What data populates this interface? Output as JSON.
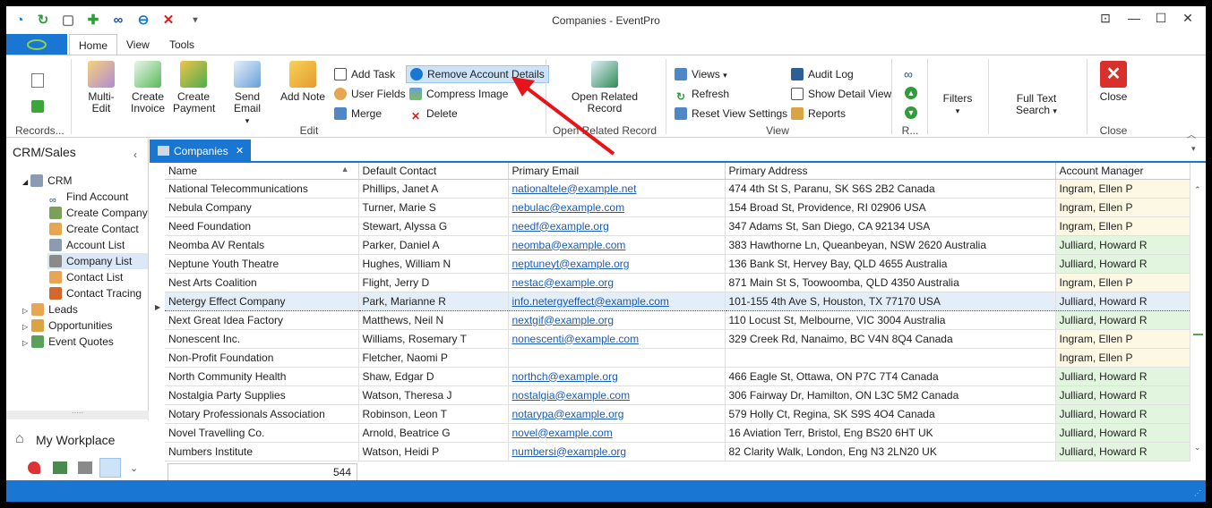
{
  "window": {
    "title": "Companies - EventPro"
  },
  "quick_access": [
    "app-icon",
    "refresh-icon",
    "new-icon",
    "add-icon",
    "find-icon",
    "remove-icon",
    "close-icon",
    "dropdown-icon"
  ],
  "ribbon_tabs": [
    {
      "label": "Home"
    },
    {
      "label": "View"
    },
    {
      "label": "Tools"
    }
  ],
  "ribbon": {
    "records": {
      "label": "Records..."
    },
    "edit": {
      "label": "Edit",
      "multi_edit": "Multi-Edit",
      "create_invoice": "Create Invoice",
      "create_payment": "Create Payment",
      "send_email": "Send Email",
      "add_note": "Add Note",
      "add_task": "Add Task",
      "user_fields": "User Fields",
      "merge": "Merge",
      "remove_account_details": "Remove Account Details",
      "compress_image": "Compress Image",
      "delete": "Delete"
    },
    "open_related": {
      "label": "Open Related Record",
      "button": "Open Related Record"
    },
    "view": {
      "label": "View",
      "views": "Views",
      "refresh": "Refresh",
      "reset_view_settings": "Reset View Settings",
      "audit_log": "Audit Log",
      "show_detail_view": "Show Detail View",
      "reports": "Reports"
    },
    "r_group": {
      "label": "R..."
    },
    "filters": "Filters",
    "full_text_search": "Full Text Search",
    "close": {
      "label": "Close",
      "button": "Close"
    }
  },
  "nav": {
    "title": "CRM/Sales",
    "crm": "CRM",
    "items": [
      "Find Account",
      "Create Company",
      "Create Contact",
      "Account List",
      "Company List",
      "Contact List",
      "Contact Tracing"
    ],
    "leads": "Leads",
    "opportunities": "Opportunities",
    "event_quotes": "Event Quotes",
    "workplace": "My Workplace"
  },
  "doc_tab": {
    "label": "Companies"
  },
  "grid": {
    "columns": [
      "Name",
      "Default Contact",
      "Primary Email",
      "Primary Address",
      "Account Manager"
    ],
    "rows": [
      {
        "name": "National Telecommunications",
        "contact": "Phillips, Janet A",
        "email": "nationaltele@example.net",
        "address": "474 4th St S, Paranu, SK S6S 2B2 Canada",
        "manager": "Ingram, Ellen P"
      },
      {
        "name": "Nebula Company",
        "contact": "Turner, Marie S",
        "email": "nebulac@example.com",
        "address": "154 Broad St, Providence, RI 02906 USA",
        "manager": "Ingram, Ellen P"
      },
      {
        "name": "Need Foundation",
        "contact": "Stewart, Alyssa G",
        "email": "needf@example.org",
        "address": "347 Adams St, San Diego, CA 92134 USA",
        "manager": "Ingram, Ellen P"
      },
      {
        "name": "Neomba AV Rentals",
        "contact": "Parker, Daniel A",
        "email": "neomba@example.com",
        "address": "383 Hawthorne Ln, Queanbeyan, NSW 2620 Australia",
        "manager": "Julliard, Howard R"
      },
      {
        "name": "Neptune Youth Theatre",
        "contact": "Hughes, William N",
        "email": "neptuneyt@example.org",
        "address": "136 Bank St, Hervey Bay, QLD 4655 Australia",
        "manager": "Julliard, Howard R"
      },
      {
        "name": "Nest Arts Coalition",
        "contact": "Flight, Jerry D",
        "email": "nestac@example.org",
        "address": "871 Main St S, Toowoomba, QLD 4350 Australia",
        "manager": "Ingram, Ellen P"
      },
      {
        "name": "Netergy Effect Company",
        "contact": "Park, Marianne R",
        "email": "info.netergyeffect@example.com",
        "address": "101-155 4th Ave S, Houston, TX 77170 USA",
        "manager": "Julliard, Howard R"
      },
      {
        "name": "Next Great Idea Factory",
        "contact": "Matthews, Neil N",
        "email": "nextgif@example.org",
        "address": "110 Locust St, Melbourne, VIC 3004 Australia",
        "manager": "Julliard, Howard R"
      },
      {
        "name": "Nonescent Inc.",
        "contact": "Williams, Rosemary T",
        "email": "nonescenti@example.com",
        "address": "329 Creek Rd, Nanaimo, BC V4N 8Q4 Canada",
        "manager": "Ingram, Ellen P"
      },
      {
        "name": "Non-Profit Foundation",
        "contact": "Fletcher, Naomi P",
        "email": "",
        "address": "",
        "manager": "Ingram, Ellen P"
      },
      {
        "name": "North Community Health",
        "contact": "Shaw, Edgar D",
        "email": "northch@example.org",
        "address": "466 Eagle St, Ottawa, ON P7C 7T4 Canada",
        "manager": "Julliard, Howard R"
      },
      {
        "name": "Nostalgia Party Supplies",
        "contact": "Watson, Theresa J",
        "email": "nostalgia@example.com",
        "address": "306 Fairway Dr, Hamilton, ON L3C 5M2 Canada",
        "manager": "Julliard, Howard R"
      },
      {
        "name": "Notary Professionals Association",
        "contact": "Robinson, Leon T",
        "email": "notarypa@example.org",
        "address": "579 Holly Ct, Regina, SK S9S 4O4 Canada",
        "manager": "Julliard, Howard R"
      },
      {
        "name": "Novel Travelling Co.",
        "contact": "Arnold, Beatrice G",
        "email": "novel@example.com",
        "address": "16 Aviation Terr, Bristol, Eng BS20 6HT UK",
        "manager": "Julliard, Howard R"
      },
      {
        "name": "Numbers Institute",
        "contact": "Watson, Heidi P",
        "email": "numbersi@example.org",
        "address": "82 Clarity Walk, London, Eng N3 2LN20 UK",
        "manager": "Julliard, Howard R"
      }
    ],
    "focused_row": 6,
    "record_count": "544"
  },
  "colors": {
    "accent": "#1976d2",
    "manager_ingram": "#fcf8e3",
    "manager_julliard": "#e2f5df",
    "arrow": "#e8141b"
  }
}
